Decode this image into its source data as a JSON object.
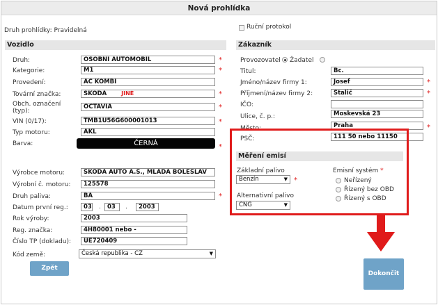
{
  "header": {
    "title": "Nová prohlídka"
  },
  "druh_prohlidky": "Druh prohlídky: Pravidelná",
  "rucni_protokol": "Ruční protokol",
  "vozidlo": {
    "title": "Vozidlo",
    "druh": {
      "label": "Druh:",
      "value": "OSOBNÍ AUTOMOBIL"
    },
    "kategorie": {
      "label": "Kategorie:",
      "value": "M1"
    },
    "provedeni": {
      "label": "Provedení:",
      "value": "AC KOMBI"
    },
    "tovarni_znacka": {
      "label": "Tovární značka:",
      "value": "ŠKODA",
      "extra": "JINÉ"
    },
    "obch_oznaceni": {
      "label_1": "Obch. označení",
      "label_2": "(typ):",
      "value": "OCTAVIA"
    },
    "vin": {
      "label": "VIN (0/17):",
      "value": "TMB1U56G600001013"
    },
    "typ_motoru": {
      "label": "Typ motoru:",
      "value": "AKL"
    },
    "barva": {
      "label": "Barva:",
      "value": "ČERNÁ"
    },
    "vyrobce_motoru": {
      "label": "Výrobce motoru:",
      "value": "ŠKODA AUTO A.S., MLADÁ BOLESLAV"
    },
    "vyrobni_cislo": {
      "label": "Výrobní č. motoru:",
      "value": "125578"
    },
    "druh_paliva": {
      "label": "Druh paliva:",
      "value": "BA"
    },
    "datum_registrace": {
      "label": "Datum první reg.:",
      "day": "03",
      "month": "03",
      "year": "2003",
      "sep": "."
    },
    "rok_vyroby": {
      "label": "Rok výroby:",
      "value": "2003"
    },
    "reg_znacka": {
      "label": "Reg. značka:",
      "value": "4H80001 nebo -"
    },
    "cislo_tp": {
      "label": "Číslo TP (dokladu):",
      "value": "UE720409"
    },
    "kod_zeme": {
      "label": "Kód země:",
      "value": "Česká republika - CZ"
    },
    "zpet": "Zpět"
  },
  "zakaznik": {
    "title": "Zákazník",
    "provozovatel": "Provozovatel",
    "zadatel": "Žadatel",
    "titul": {
      "label": "Titul:",
      "value": "Bc."
    },
    "jmeno": {
      "label": "Jméno/název firmy 1:",
      "value": "Josef"
    },
    "prijmeni": {
      "label": "Příjmení/název firmy 2:",
      "value": "Stalič"
    },
    "ico": {
      "label": "IČO:",
      "value": ""
    },
    "ulice": {
      "label": "Ulice, č. p.:",
      "value": "Moskevská 23"
    },
    "mesto": {
      "label": "Město:",
      "value": "Praha"
    },
    "psc": {
      "label": "PSČ:",
      "value": "111 50 nebo 11150"
    }
  },
  "mereni": {
    "title": "Měření emisí",
    "zakladni_palivo": {
      "label": "Základní palivo",
      "value": "Benzín"
    },
    "alternativni_palivo": {
      "label": "Alternativní palivo",
      "value": "CNG"
    },
    "emisni_system": {
      "label": "Emisní systém",
      "options": [
        "Neřízený",
        "Řízený bez OBD",
        "Řízený s OBD"
      ]
    }
  },
  "dokoncit": "Dokončit",
  "colors": {
    "highlight": "#e01b1b",
    "button": "#6fa3c8",
    "required": "#e02020"
  },
  "icons": {
    "dropdown": "triangle-down",
    "arrow": "red-down-arrow"
  }
}
